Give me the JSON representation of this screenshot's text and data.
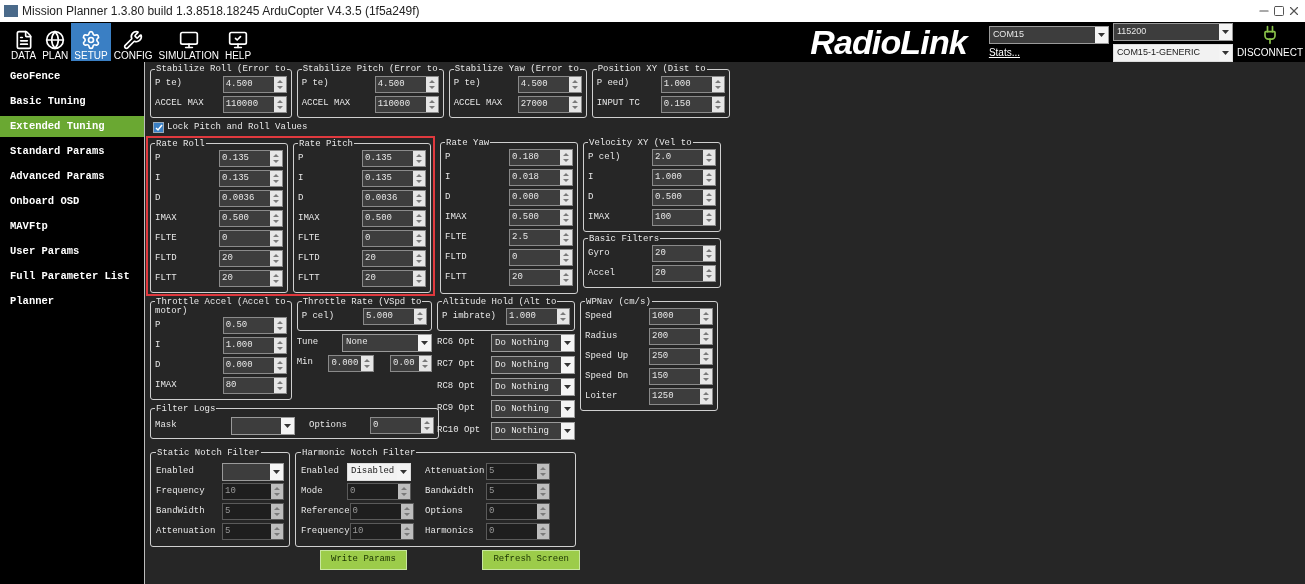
{
  "window": {
    "title": "Mission Planner 1.3.80 build 1.3.8518.18245 ArduCopter V4.3.5 (1f5a249f)"
  },
  "toolbar": {
    "items": [
      {
        "label": "DATA",
        "kind": "data",
        "selected": false
      },
      {
        "label": "PLAN",
        "kind": "plan",
        "selected": false
      },
      {
        "label": "SETUP",
        "kind": "setup",
        "selected": true
      },
      {
        "label": "CONFIG",
        "kind": "config",
        "selected": false
      },
      {
        "label": "SIMULATION",
        "kind": "simulation",
        "selected": false
      },
      {
        "label": "HELP",
        "kind": "help",
        "selected": false
      }
    ],
    "logo": "RadioLink",
    "port": "COM15",
    "baud": "115200",
    "stats_link": "Stats...",
    "device": "COM15-1-GENERIC",
    "connect_button": "DISCONNECT"
  },
  "sidebar": {
    "items": [
      {
        "label": "GeoFence",
        "selected": false
      },
      {
        "label": "Basic Tuning",
        "selected": false
      },
      {
        "label": "Extended Tuning",
        "selected": true
      },
      {
        "label": "Standard Params",
        "selected": false
      },
      {
        "label": "Advanced Params",
        "selected": false
      },
      {
        "label": "Onboard OSD",
        "selected": false
      },
      {
        "label": "MAVFtp",
        "selected": false
      },
      {
        "label": "User Params",
        "selected": false
      },
      {
        "label": "Full Parameter List",
        "selected": false
      },
      {
        "label": "Planner",
        "selected": false
      }
    ]
  },
  "params": {
    "top_groups": [
      {
        "title": "Stabilize Roll (Error to",
        "rows": [
          {
            "label": "P te)",
            "value": "4.500"
          },
          {
            "label": "ACCEL MAX",
            "value": "110000"
          }
        ]
      },
      {
        "title": "Stabilize Pitch (Error to",
        "rows": [
          {
            "label": "P te)",
            "value": "4.500"
          },
          {
            "label": "ACCEL MAX",
            "value": "110000"
          }
        ]
      },
      {
        "title": "Stabilize Yaw (Error to",
        "rows": [
          {
            "label": "P te)",
            "value": "4.500"
          },
          {
            "label": "ACCEL MAX",
            "value": "27000"
          }
        ]
      },
      {
        "title": "Position XY (Dist to",
        "rows": [
          {
            "label": "P eed)",
            "value": "1.000"
          },
          {
            "label": "INPUT TC",
            "value": "0.150"
          }
        ]
      }
    ],
    "lock_checkbox": {
      "label": "Lock Pitch and Roll Values",
      "checked": true
    },
    "rate_groups": [
      {
        "title": "Rate Roll",
        "highlighted": true,
        "rows": [
          {
            "label": "P",
            "value": "0.135"
          },
          {
            "label": "I",
            "value": "0.135"
          },
          {
            "label": "D",
            "value": "0.0036"
          },
          {
            "label": "IMAX",
            "value": "0.500"
          },
          {
            "label": "FLTE",
            "value": "0"
          },
          {
            "label": "FLTD",
            "value": "20"
          },
          {
            "label": "FLTT",
            "value": "20"
          }
        ]
      },
      {
        "title": "Rate Pitch",
        "highlighted": true,
        "rows": [
          {
            "label": "P",
            "value": "0.135"
          },
          {
            "label": "I",
            "value": "0.135"
          },
          {
            "label": "D",
            "value": "0.0036"
          },
          {
            "label": "IMAX",
            "value": "0.500"
          },
          {
            "label": "FLTE",
            "value": "0"
          },
          {
            "label": "FLTD",
            "value": "20"
          },
          {
            "label": "FLTT",
            "value": "20"
          }
        ]
      },
      {
        "title": "Rate Yaw",
        "highlighted": false,
        "rows": [
          {
            "label": "P",
            "value": "0.180"
          },
          {
            "label": "I",
            "value": "0.018"
          },
          {
            "label": "D",
            "value": "0.000"
          },
          {
            "label": "IMAX",
            "value": "0.500"
          },
          {
            "label": "FLTE",
            "value": "2.5"
          },
          {
            "label": "FLTD",
            "value": "0"
          },
          {
            "label": "FLTT",
            "value": "20"
          }
        ]
      }
    ],
    "velocity_xy": {
      "title": "Velocity XY (Vel to",
      "rows": [
        {
          "label": "P cel)",
          "value": "2.0"
        },
        {
          "label": "I",
          "value": "1.000"
        },
        {
          "label": "D",
          "value": "0.500"
        },
        {
          "label": "IMAX",
          "value": "100"
        }
      ]
    },
    "basic_filters": {
      "title": "Basic Filters",
      "rows": [
        {
          "label": "Gyro",
          "value": "20"
        },
        {
          "label": "Accel",
          "value": "20"
        }
      ]
    },
    "throttle_accel": {
      "title": "Throttle Accel (Accel to",
      "note": "motor)",
      "rows": [
        {
          "label": "P",
          "value": "0.50"
        },
        {
          "label": "I",
          "value": "1.000"
        },
        {
          "label": "D",
          "value": "0.000"
        },
        {
          "label": "IMAX",
          "value": "80"
        }
      ]
    },
    "throttle_rate": {
      "title": "Throttle Rate (VSpd to",
      "rows": [
        {
          "label": "P cel)",
          "value": "5.000"
        }
      ]
    },
    "tune": {
      "label": "Tune",
      "value": "None",
      "min_label": "Min",
      "min_value": "0.000",
      "max_value": "0.00"
    },
    "altitude_hold": {
      "title": "Altitude Hold (Alt to",
      "rows": [
        {
          "label": "P imbrate)",
          "value": "1.000"
        }
      ]
    },
    "rc_options": [
      {
        "label": "RC6 Opt",
        "value": "Do Nothing"
      },
      {
        "label": "RC7 Opt",
        "value": "Do Nothing"
      },
      {
        "label": "RC8 Opt",
        "value": "Do Nothing"
      },
      {
        "label": "RC9 Opt",
        "value": "Do Nothing"
      },
      {
        "label": "RC10 Opt",
        "value": "Do Nothing"
      }
    ],
    "wpnav": {
      "title": "WPNav (cm/s)",
      "rows": [
        {
          "label": "Speed",
          "value": "1000"
        },
        {
          "label": "Radius",
          "value": "200"
        },
        {
          "label": "Speed Up",
          "value": "250"
        },
        {
          "label": "Speed Dn",
          "value": "150"
        },
        {
          "label": "Loiter",
          "value": "1250"
        }
      ]
    },
    "filter_logs": {
      "title": "Filter Logs",
      "mask_label": "Mask",
      "options_label": "Options",
      "options_value": "0"
    },
    "static_notch": {
      "title": "Static Notch Filter",
      "enabled_label": "Enabled",
      "rows": [
        {
          "label": "Frequency",
          "value": "10",
          "disabled": true
        },
        {
          "label": "BandWidth",
          "value": "5",
          "disabled": true
        },
        {
          "label": "Attenuation",
          "value": "5",
          "disabled": true
        }
      ]
    },
    "harmonic_notch": {
      "title": "Harmonic Notch Filter",
      "enabled_label": "Enabled",
      "enabled_value": "Disabled",
      "left_rows": [
        {
          "label": "Mode",
          "value": "0",
          "disabled": true
        },
        {
          "label": "Reference",
          "value": "0",
          "disabled": true
        },
        {
          "label": "Frequency",
          "value": "10",
          "disabled": true
        }
      ],
      "right_rows": [
        {
          "label": "Attenuation",
          "value": "5",
          "disabled": true
        },
        {
          "label": "Bandwidth",
          "value": "5",
          "disabled": true
        },
        {
          "label": "Options",
          "value": "0",
          "disabled": true
        },
        {
          "label": "Harmonics",
          "value": "0",
          "disabled": true
        }
      ]
    },
    "buttons": [
      "Write Params",
      "Refresh Screen"
    ]
  }
}
